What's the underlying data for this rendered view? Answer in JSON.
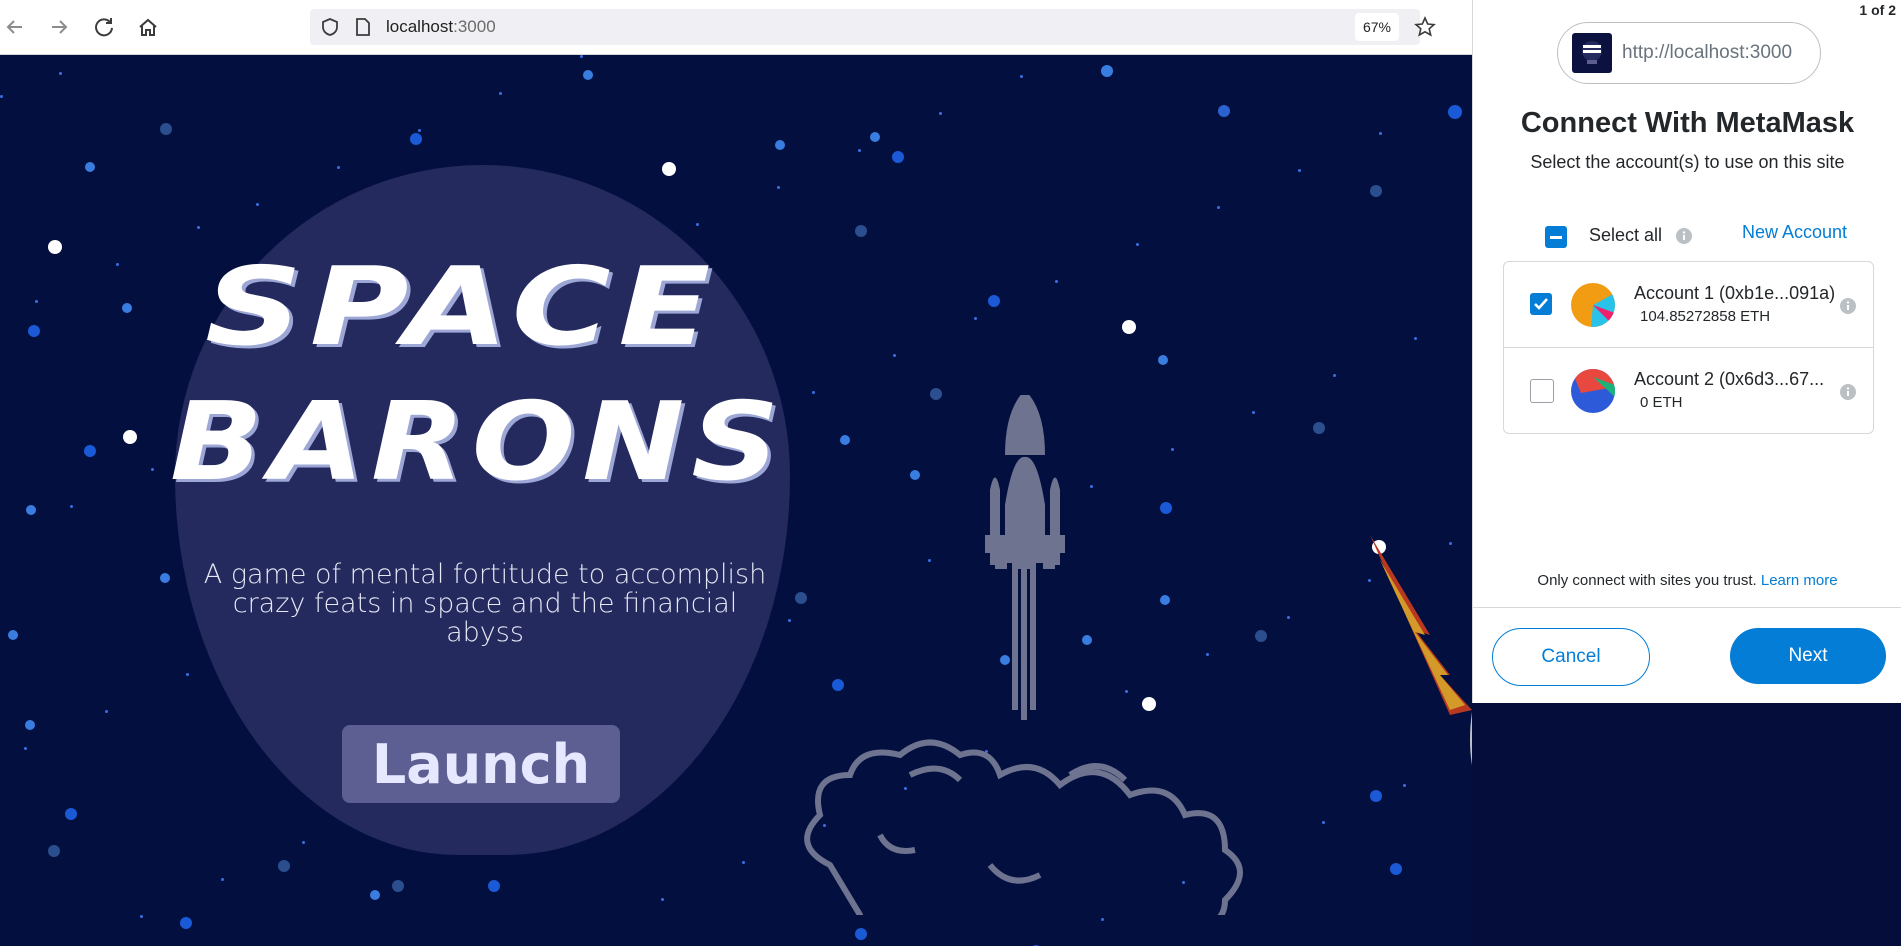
{
  "browser": {
    "url_host": "localhost",
    "url_port": ":3000",
    "zoom": "67%"
  },
  "page": {
    "title_line1": "SPACE",
    "title_line2": "BARONS",
    "tagline": "A game of mental fortitude to accomplish crazy feats in space and the financial abyss",
    "launch_label": "Launch"
  },
  "metamask": {
    "page_count": "1 of 2",
    "origin_url": "http://localhost:3000",
    "title": "Connect With MetaMask",
    "subtitle": "Select the account(s) to use on this site",
    "select_all_label": "Select all",
    "new_account_label": "New Account",
    "accounts": [
      {
        "name": "Account 1 (0xb1e...091a)",
        "balance": "104.85272858 ETH",
        "checked": true
      },
      {
        "name": "Account 2 (0x6d3...67...",
        "balance": "0 ETH",
        "checked": false
      }
    ],
    "trust_text": "Only connect with sites you trust.",
    "learn_more_label": "Learn more",
    "cancel_label": "Cancel",
    "next_label": "Next"
  },
  "colors": {
    "space_bg": "#03103f",
    "moon": "#242a5e",
    "launch_button": "#5d5f92",
    "metamask_blue": "#037dd6"
  }
}
